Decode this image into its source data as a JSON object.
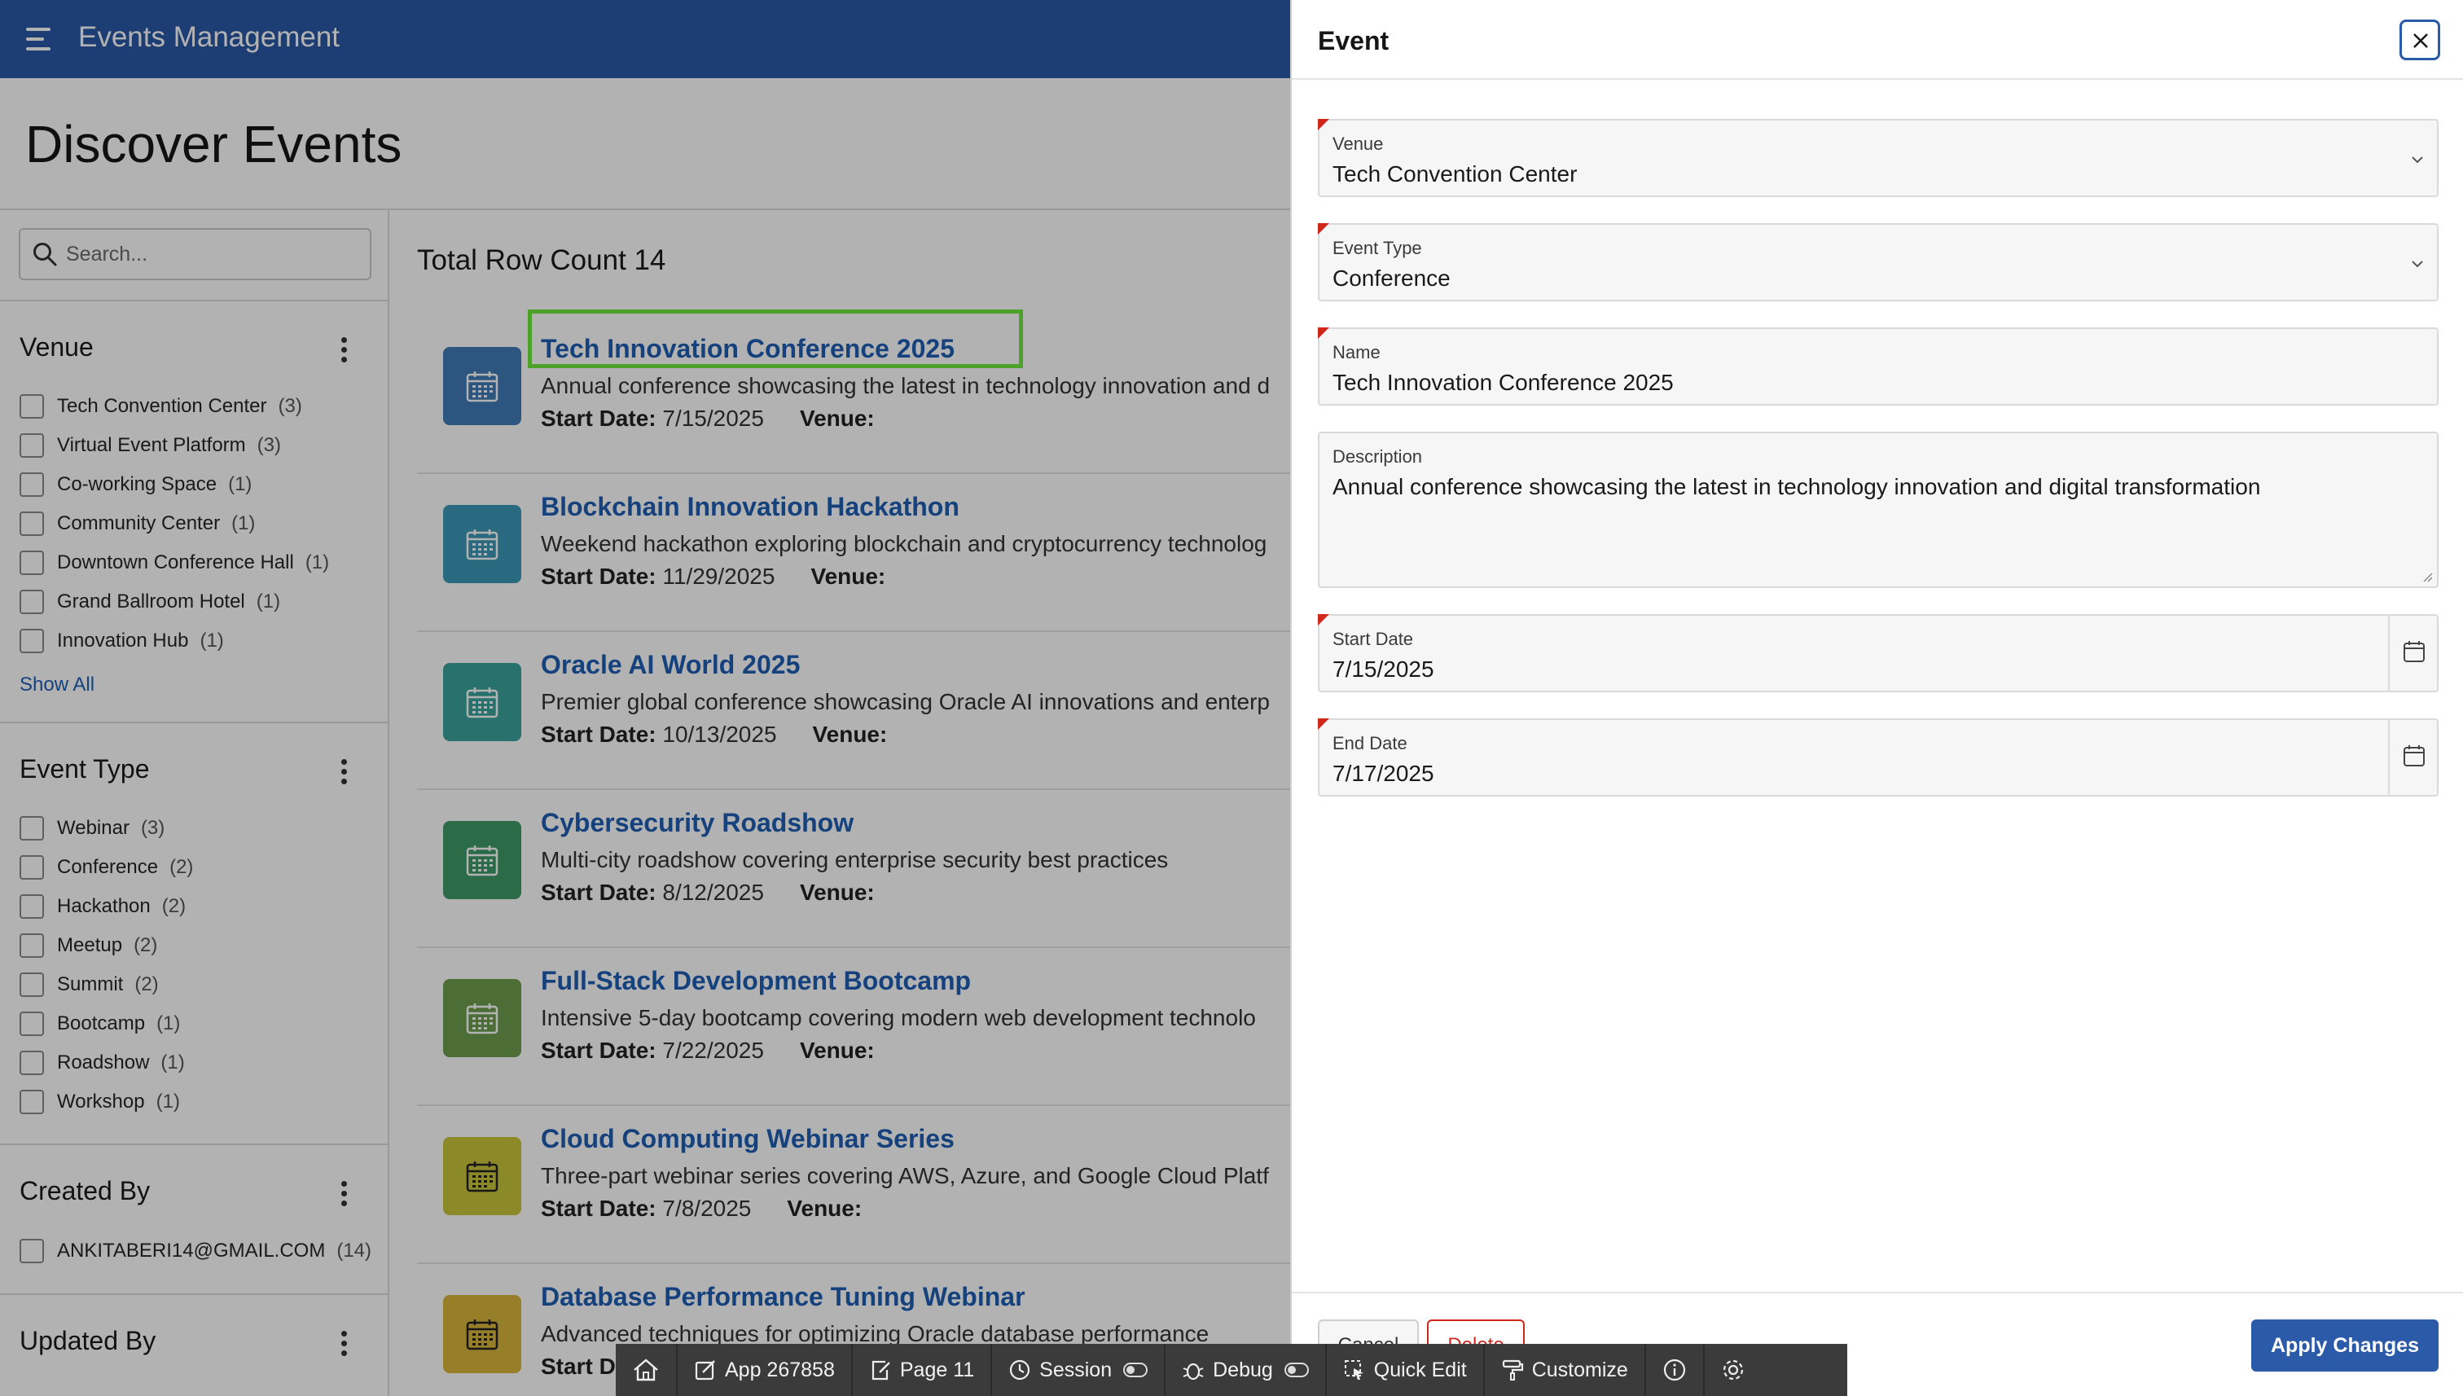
{
  "app": {
    "title": "Events Management"
  },
  "page": {
    "title": "Discover Events"
  },
  "search": {
    "placeholder": "Search..."
  },
  "facets": {
    "venue": {
      "title": "Venue",
      "items": [
        {
          "label": "Tech Convention Center",
          "count": "(3)"
        },
        {
          "label": "Virtual Event Platform",
          "count": "(3)"
        },
        {
          "label": "Co-working Space",
          "count": "(1)"
        },
        {
          "label": "Community Center",
          "count": "(1)"
        },
        {
          "label": "Downtown Conference Hall",
          "count": "(1)"
        },
        {
          "label": "Grand Ballroom Hotel",
          "count": "(1)"
        },
        {
          "label": "Innovation Hub",
          "count": "(1)"
        }
      ],
      "show_all": "Show All"
    },
    "event_type": {
      "title": "Event Type",
      "items": [
        {
          "label": "Webinar",
          "count": "(3)"
        },
        {
          "label": "Conference",
          "count": "(2)"
        },
        {
          "label": "Hackathon",
          "count": "(2)"
        },
        {
          "label": "Meetup",
          "count": "(2)"
        },
        {
          "label": "Summit",
          "count": "(2)"
        },
        {
          "label": "Bootcamp",
          "count": "(1)"
        },
        {
          "label": "Roadshow",
          "count": "(1)"
        },
        {
          "label": "Workshop",
          "count": "(1)"
        }
      ]
    },
    "created_by": {
      "title": "Created By",
      "items": [
        {
          "label": "ANKITABERI14@GMAIL.COM",
          "count": "(14)"
        }
      ]
    },
    "updated_by": {
      "title": "Updated By"
    }
  },
  "results": {
    "row_count_label": "Total Row Count 14",
    "start_date_label": "Start Date:",
    "venue_label": "Venue:",
    "events": [
      {
        "title": "Tech Innovation Conference 2025",
        "description": "Annual conference showcasing the latest in technology innovation and d",
        "start_date": "7/15/2025",
        "icon_color": "#3f7cb8"
      },
      {
        "title": "Blockchain Innovation Hackathon",
        "description": "Weekend hackathon exploring blockchain and cryptocurrency technolog",
        "start_date": "11/29/2025",
        "icon_color": "#3d98b8"
      },
      {
        "title": "Oracle AI World 2025",
        "description": "Premier global conference showcasing Oracle AI innovations and enterp",
        "start_date": "10/13/2025",
        "icon_color": "#3aa39c"
      },
      {
        "title": "Cybersecurity Roadshow",
        "description": "Multi-city roadshow covering enterprise security best practices",
        "start_date": "8/12/2025",
        "icon_color": "#3e9a68"
      },
      {
        "title": "Full-Stack Development Bootcamp",
        "description": "Intensive 5-day bootcamp covering modern web development technolo",
        "start_date": "7/22/2025",
        "icon_color": "#6e9e4e"
      },
      {
        "title": "Cloud Computing Webinar Series",
        "description": "Three-part webinar series covering AWS, Azure, and Google Cloud Platf",
        "start_date": "7/8/2025",
        "icon_color": "#c9c43a"
      },
      {
        "title": "Database Performance Tuning Webinar",
        "description": "Advanced techniques for optimizing Oracle database performance",
        "start_date": "",
        "icon_color": "#d9b53b"
      }
    ],
    "partial_meta": "Start D"
  },
  "drawer": {
    "title": "Event",
    "fields": {
      "venue": {
        "label": "Venue",
        "value": "Tech Convention Center"
      },
      "event_type": {
        "label": "Event Type",
        "value": "Conference"
      },
      "name": {
        "label": "Name",
        "value": "Tech Innovation Conference 2025"
      },
      "description": {
        "label": "Description",
        "value": "Annual conference showcasing the latest in technology innovation and digital transformation"
      },
      "start_date": {
        "label": "Start Date",
        "value": "7/15/2025"
      },
      "end_date": {
        "label": "End Date",
        "value": "7/17/2025"
      }
    },
    "buttons": {
      "cancel": "Cancel",
      "delete": "Delete",
      "apply": "Apply Changes"
    }
  },
  "devbar": {
    "app": "App 267858",
    "page": "Page 11",
    "session": "Session",
    "debug": "Debug",
    "quick_edit": "Quick Edit",
    "customize": "Customize"
  },
  "colors": {
    "header": "#2a5aa8",
    "link": "#1f5eb4",
    "required": "#d0271d",
    "highlight": "#6ee83b"
  }
}
